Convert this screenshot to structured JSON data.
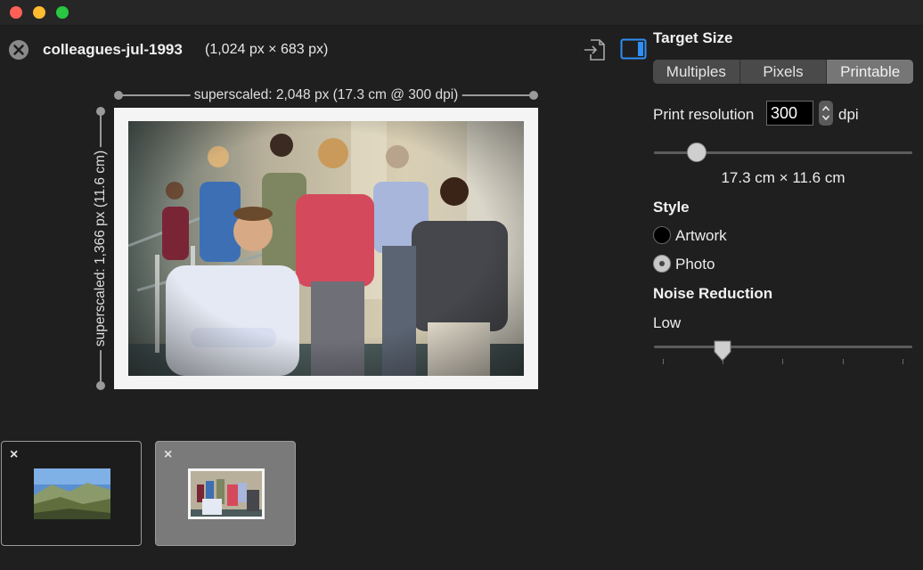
{
  "document": {
    "name": "colleagues-jul-1993",
    "dimensions": "(1,024 px × 683 px)"
  },
  "rulers": {
    "width_label": "superscaled: 2,048 px (17.3 cm @ 300 dpi)",
    "height_label": "superscaled: 1,366 px (11.6 cm)"
  },
  "panel": {
    "target_size_title": "Target Size",
    "tabs": [
      {
        "label": "Multiples",
        "active": false
      },
      {
        "label": "Pixels",
        "active": false
      },
      {
        "label": "Printable",
        "active": true
      }
    ],
    "print_resolution_label": "Print resolution",
    "print_resolution_value": "300",
    "dpi_unit": "dpi",
    "resolution_slider_level": 0.17,
    "print_size": "17.3 cm × 11.6 cm",
    "style_title": "Style",
    "style_options": [
      {
        "label": "Artwork",
        "selected": false
      },
      {
        "label": "Photo",
        "selected": true
      }
    ],
    "noise_title": "Noise Reduction",
    "noise_value": "Low",
    "noise_slider_level": 0.25
  },
  "icons": {
    "close": "close-circle-icon",
    "export": "export-icon",
    "sidebar": "sidebar-toggle-icon",
    "remove": "×"
  },
  "colors": {
    "accent": "#2f8ff4",
    "frame": "#f4f4f4"
  }
}
